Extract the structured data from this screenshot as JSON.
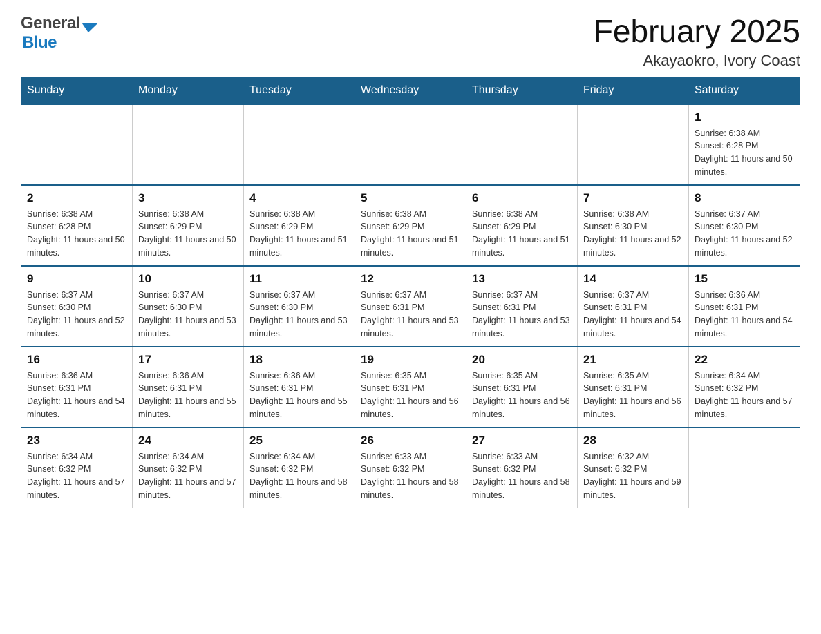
{
  "header": {
    "logo_general": "General",
    "logo_blue": "Blue",
    "title": "February 2025",
    "subtitle": "Akayaokro, Ivory Coast"
  },
  "weekdays": [
    "Sunday",
    "Monday",
    "Tuesday",
    "Wednesday",
    "Thursday",
    "Friday",
    "Saturday"
  ],
  "weeks": [
    [
      {
        "day": "",
        "sunrise": "",
        "sunset": "",
        "daylight": "",
        "empty": true
      },
      {
        "day": "",
        "sunrise": "",
        "sunset": "",
        "daylight": "",
        "empty": true
      },
      {
        "day": "",
        "sunrise": "",
        "sunset": "",
        "daylight": "",
        "empty": true
      },
      {
        "day": "",
        "sunrise": "",
        "sunset": "",
        "daylight": "",
        "empty": true
      },
      {
        "day": "",
        "sunrise": "",
        "sunset": "",
        "daylight": "",
        "empty": true
      },
      {
        "day": "",
        "sunrise": "",
        "sunset": "",
        "daylight": "",
        "empty": true
      },
      {
        "day": "1",
        "sunrise": "Sunrise: 6:38 AM",
        "sunset": "Sunset: 6:28 PM",
        "daylight": "Daylight: 11 hours and 50 minutes.",
        "empty": false
      }
    ],
    [
      {
        "day": "2",
        "sunrise": "Sunrise: 6:38 AM",
        "sunset": "Sunset: 6:28 PM",
        "daylight": "Daylight: 11 hours and 50 minutes.",
        "empty": false
      },
      {
        "day": "3",
        "sunrise": "Sunrise: 6:38 AM",
        "sunset": "Sunset: 6:29 PM",
        "daylight": "Daylight: 11 hours and 50 minutes.",
        "empty": false
      },
      {
        "day": "4",
        "sunrise": "Sunrise: 6:38 AM",
        "sunset": "Sunset: 6:29 PM",
        "daylight": "Daylight: 11 hours and 51 minutes.",
        "empty": false
      },
      {
        "day": "5",
        "sunrise": "Sunrise: 6:38 AM",
        "sunset": "Sunset: 6:29 PM",
        "daylight": "Daylight: 11 hours and 51 minutes.",
        "empty": false
      },
      {
        "day": "6",
        "sunrise": "Sunrise: 6:38 AM",
        "sunset": "Sunset: 6:29 PM",
        "daylight": "Daylight: 11 hours and 51 minutes.",
        "empty": false
      },
      {
        "day": "7",
        "sunrise": "Sunrise: 6:38 AM",
        "sunset": "Sunset: 6:30 PM",
        "daylight": "Daylight: 11 hours and 52 minutes.",
        "empty": false
      },
      {
        "day": "8",
        "sunrise": "Sunrise: 6:37 AM",
        "sunset": "Sunset: 6:30 PM",
        "daylight": "Daylight: 11 hours and 52 minutes.",
        "empty": false
      }
    ],
    [
      {
        "day": "9",
        "sunrise": "Sunrise: 6:37 AM",
        "sunset": "Sunset: 6:30 PM",
        "daylight": "Daylight: 11 hours and 52 minutes.",
        "empty": false
      },
      {
        "day": "10",
        "sunrise": "Sunrise: 6:37 AM",
        "sunset": "Sunset: 6:30 PM",
        "daylight": "Daylight: 11 hours and 53 minutes.",
        "empty": false
      },
      {
        "day": "11",
        "sunrise": "Sunrise: 6:37 AM",
        "sunset": "Sunset: 6:30 PM",
        "daylight": "Daylight: 11 hours and 53 minutes.",
        "empty": false
      },
      {
        "day": "12",
        "sunrise": "Sunrise: 6:37 AM",
        "sunset": "Sunset: 6:31 PM",
        "daylight": "Daylight: 11 hours and 53 minutes.",
        "empty": false
      },
      {
        "day": "13",
        "sunrise": "Sunrise: 6:37 AM",
        "sunset": "Sunset: 6:31 PM",
        "daylight": "Daylight: 11 hours and 53 minutes.",
        "empty": false
      },
      {
        "day": "14",
        "sunrise": "Sunrise: 6:37 AM",
        "sunset": "Sunset: 6:31 PM",
        "daylight": "Daylight: 11 hours and 54 minutes.",
        "empty": false
      },
      {
        "day": "15",
        "sunrise": "Sunrise: 6:36 AM",
        "sunset": "Sunset: 6:31 PM",
        "daylight": "Daylight: 11 hours and 54 minutes.",
        "empty": false
      }
    ],
    [
      {
        "day": "16",
        "sunrise": "Sunrise: 6:36 AM",
        "sunset": "Sunset: 6:31 PM",
        "daylight": "Daylight: 11 hours and 54 minutes.",
        "empty": false
      },
      {
        "day": "17",
        "sunrise": "Sunrise: 6:36 AM",
        "sunset": "Sunset: 6:31 PM",
        "daylight": "Daylight: 11 hours and 55 minutes.",
        "empty": false
      },
      {
        "day": "18",
        "sunrise": "Sunrise: 6:36 AM",
        "sunset": "Sunset: 6:31 PM",
        "daylight": "Daylight: 11 hours and 55 minutes.",
        "empty": false
      },
      {
        "day": "19",
        "sunrise": "Sunrise: 6:35 AM",
        "sunset": "Sunset: 6:31 PM",
        "daylight": "Daylight: 11 hours and 56 minutes.",
        "empty": false
      },
      {
        "day": "20",
        "sunrise": "Sunrise: 6:35 AM",
        "sunset": "Sunset: 6:31 PM",
        "daylight": "Daylight: 11 hours and 56 minutes.",
        "empty": false
      },
      {
        "day": "21",
        "sunrise": "Sunrise: 6:35 AM",
        "sunset": "Sunset: 6:31 PM",
        "daylight": "Daylight: 11 hours and 56 minutes.",
        "empty": false
      },
      {
        "day": "22",
        "sunrise": "Sunrise: 6:34 AM",
        "sunset": "Sunset: 6:32 PM",
        "daylight": "Daylight: 11 hours and 57 minutes.",
        "empty": false
      }
    ],
    [
      {
        "day": "23",
        "sunrise": "Sunrise: 6:34 AM",
        "sunset": "Sunset: 6:32 PM",
        "daylight": "Daylight: 11 hours and 57 minutes.",
        "empty": false
      },
      {
        "day": "24",
        "sunrise": "Sunrise: 6:34 AM",
        "sunset": "Sunset: 6:32 PM",
        "daylight": "Daylight: 11 hours and 57 minutes.",
        "empty": false
      },
      {
        "day": "25",
        "sunrise": "Sunrise: 6:34 AM",
        "sunset": "Sunset: 6:32 PM",
        "daylight": "Daylight: 11 hours and 58 minutes.",
        "empty": false
      },
      {
        "day": "26",
        "sunrise": "Sunrise: 6:33 AM",
        "sunset": "Sunset: 6:32 PM",
        "daylight": "Daylight: 11 hours and 58 minutes.",
        "empty": false
      },
      {
        "day": "27",
        "sunrise": "Sunrise: 6:33 AM",
        "sunset": "Sunset: 6:32 PM",
        "daylight": "Daylight: 11 hours and 58 minutes.",
        "empty": false
      },
      {
        "day": "28",
        "sunrise": "Sunrise: 6:32 AM",
        "sunset": "Sunset: 6:32 PM",
        "daylight": "Daylight: 11 hours and 59 minutes.",
        "empty": false
      },
      {
        "day": "",
        "sunrise": "",
        "sunset": "",
        "daylight": "",
        "empty": true
      }
    ]
  ]
}
